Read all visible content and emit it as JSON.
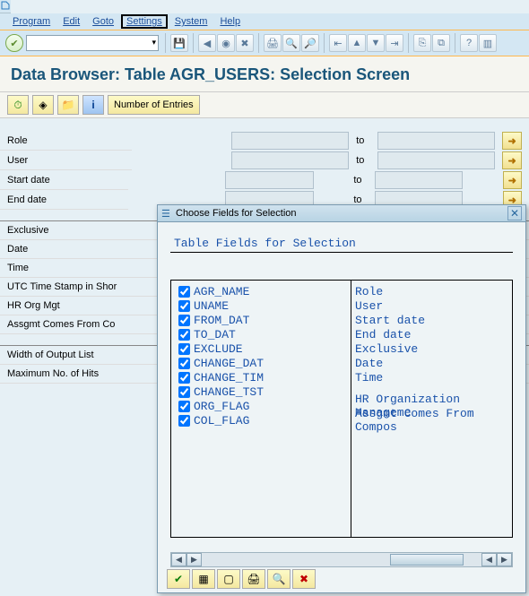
{
  "menu": {
    "program": "Program",
    "edit": "Edit",
    "goto": "Goto",
    "settings": "Settings",
    "system": "System",
    "help": "Help"
  },
  "page_title": "Data Browser: Table AGR_USERS: Selection Screen",
  "toolbar2": {
    "entries": "Number of Entries"
  },
  "sel": {
    "role": {
      "label": "Role",
      "to": "to"
    },
    "user": {
      "label": "User",
      "to": "to"
    },
    "start": {
      "label": "Start date",
      "to": "to"
    },
    "end": {
      "label": "End date",
      "to": "to"
    }
  },
  "extra_labels": [
    "Exclusive",
    "Date",
    "Time",
    "UTC Time Stamp in Shor",
    "HR Org Mgt",
    "Assgmt Comes From Co"
  ],
  "bottom": {
    "width": "Width of Output List",
    "max": "Maximum No. of Hits"
  },
  "dialog": {
    "title": "Choose Fields for Selection",
    "subhead": "Table Fields for Selection",
    "fields": [
      {
        "name": "AGR_NAME",
        "desc": "Role",
        "checked": true
      },
      {
        "name": "UNAME",
        "desc": "User",
        "checked": true
      },
      {
        "name": "FROM_DAT",
        "desc": "Start date",
        "checked": true
      },
      {
        "name": "TO_DAT",
        "desc": "End date",
        "checked": true
      },
      {
        "name": "EXCLUDE",
        "desc": "Exclusive",
        "checked": true
      },
      {
        "name": "CHANGE_DAT",
        "desc": "Date",
        "checked": true
      },
      {
        "name": "CHANGE_TIM",
        "desc": "Time",
        "checked": true
      },
      {
        "name": "CHANGE_TST",
        "desc": "",
        "checked": true
      },
      {
        "name": "ORG_FLAG",
        "desc": "HR Organization Manageme",
        "checked": true
      },
      {
        "name": "COL_FLAG",
        "desc": "Assgmt Comes From Compos",
        "checked": true
      }
    ]
  }
}
